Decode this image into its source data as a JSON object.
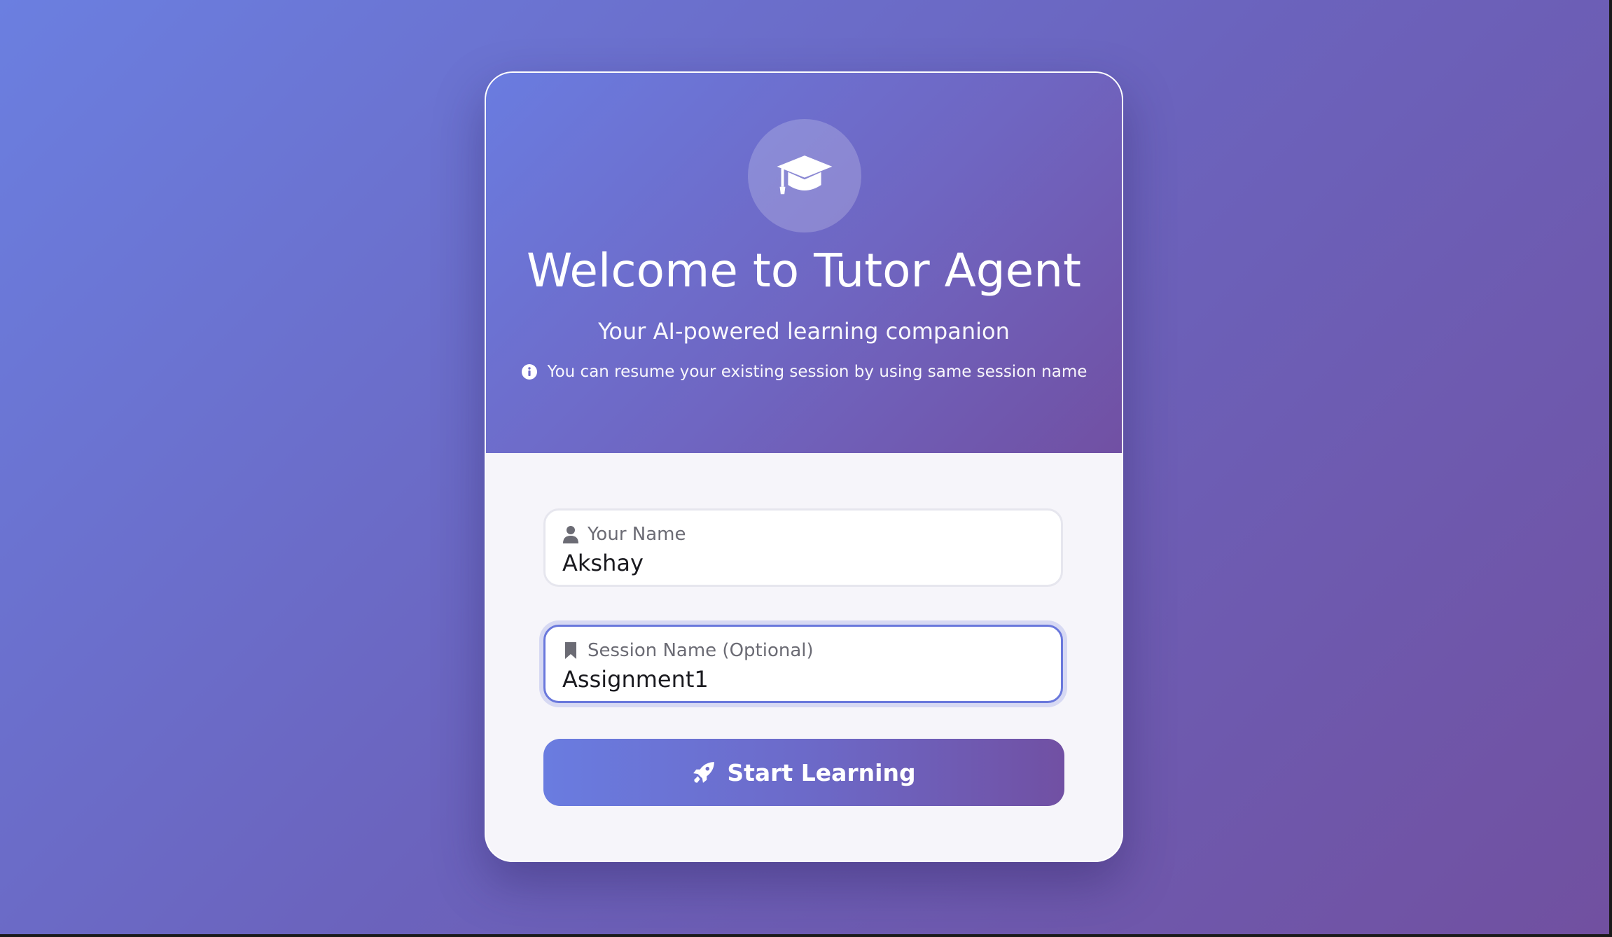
{
  "header": {
    "title": "Welcome to Tutor Agent",
    "subtitle": "Your AI-powered learning companion",
    "info": "You can resume your existing session by using same session name"
  },
  "form": {
    "name_field": {
      "label": "Your Name",
      "value": "Akshay"
    },
    "session_field": {
      "label": "Session Name (Optional)",
      "value": "Assignment1"
    },
    "submit_label": "Start Learning"
  },
  "icons": {
    "logo": "graduation-cap-icon",
    "info": "info-circle-icon",
    "name": "user-icon",
    "session": "bookmark-icon",
    "submit": "rocket-icon"
  },
  "colors": {
    "accent_start": "#6a7ce0",
    "accent_end": "#7150a3",
    "focus_border": "#6a78dc"
  }
}
